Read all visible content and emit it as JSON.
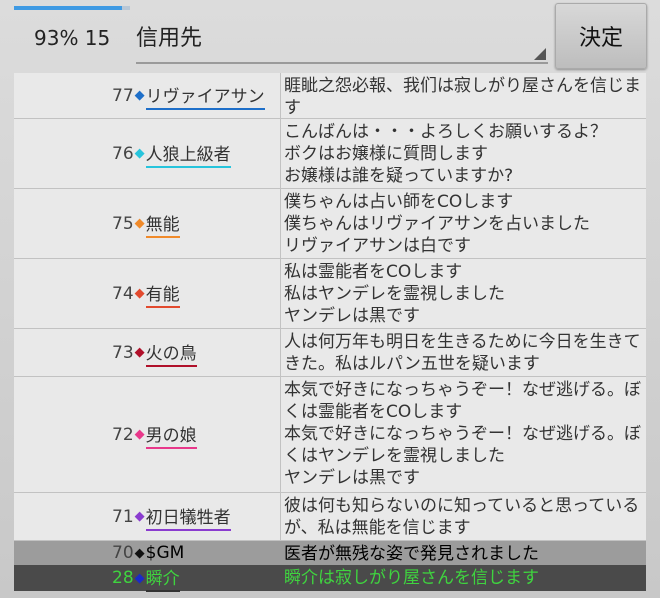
{
  "status": {
    "progress_percent": 93,
    "text": "93% 15"
  },
  "target_select": {
    "label": "信用先"
  },
  "decide_button": {
    "label": "決定"
  },
  "log": [
    {
      "num": "77",
      "name": "リヴァイアサン",
      "color": "#1e6fc9",
      "message": "睚眦之怨必報、我们は寂しがり屋さんを信じます",
      "height": 46
    },
    {
      "num": "76",
      "name": "人狼上級者",
      "color": "#27c4dc",
      "message": "こんばんは・・・よろしくお願いするよ？\nボクはお嬢様に質問します\nお嬢様は誰を疑っていますか?",
      "height": 70
    },
    {
      "num": "75",
      "name": "無能",
      "color": "#f08a2a",
      "message": "僕ちゃんは占い師をCOします\n僕ちゃんはリヴァイアサンを占いました\nリヴァイアサンは白です",
      "height": 70
    },
    {
      "num": "74",
      "name": "有能",
      "color": "#e24a2e",
      "message": "私は霊能者をCOします\n私はヤンデレを霊視しました\nヤンデレは黒です",
      "height": 70
    },
    {
      "num": "73",
      "name": "火の鳥",
      "color": "#b0102a",
      "message": "人は何万年も明日を生きるために今日を生きてきた。私はルパン五世を疑います",
      "height": 48
    },
    {
      "num": "72",
      "name": "男の娘",
      "color": "#e8388a",
      "message": "本気で好きになっちゃうぞー！なぜ逃げる。ぼくは霊能者をCOします\n本気で好きになっちゃうぞー！なぜ逃げる。ぼくはヤンデレを霊視しました\nヤンデレは黒です",
      "height": 116
    },
    {
      "num": "71",
      "name": "初日犠牲者",
      "color": "#8a3ccf",
      "message": "彼は何も知らないのに知っていると思っているが、私は無能を信じます",
      "height": 48
    }
  ],
  "system_row": {
    "num": "70",
    "name": "$GM",
    "color": "#111111",
    "message": "医者が無残な姿で発見されました"
  },
  "self_row": {
    "num": "28",
    "name": "瞬介",
    "color": "#1a2ac8",
    "message": "瞬介は寂しがり屋さんを信じます"
  }
}
